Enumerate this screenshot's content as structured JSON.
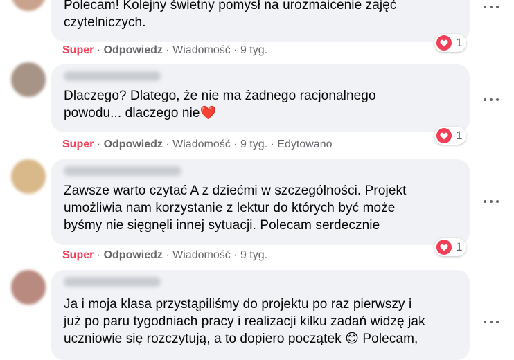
{
  "comments": [
    {
      "text": "Polecam! Kolejny świetny pomysł na urozmaicenie zajęć\nczytelniczych.",
      "reaction": "Super",
      "reply": "Odpowiedz",
      "message": "Wiadomość",
      "time": "9 tyg.",
      "edited": "",
      "reaction_count": "1"
    },
    {
      "text": "Dlaczego? Dlatego, że nie ma żadnego racjonalnego\npowodu... dlaczego nie",
      "emoji": "❤️",
      "reaction": "Super",
      "reply": "Odpowiedz",
      "message": "Wiadomość",
      "time": "9 tyg.",
      "edited": "Edytowano",
      "reaction_count": "1"
    },
    {
      "text": "Zawsze warto czytać A z dziećmi w szczególności. Projekt\numożliwia nam korzystanie z lektur do których być może\nbyśmy nie sięgnęli innej sytuacji. Polecam serdecznie",
      "reaction": "Super",
      "reply": "Odpowiedz",
      "message": "Wiadomość",
      "time": "9 tyg.",
      "edited": "",
      "reaction_count": "1"
    },
    {
      "text": "Ja i moja klasa przystąpiliśmy do projektu po raz pierwszy i\njuż po paru tygodniach pracy i realizacji kilku zadań widzę jak\nuczniowie się rozczytują, a to dopiero początek 😊 Polecam,"
    }
  ],
  "separator": "·",
  "colors": {
    "super": "#f33e58",
    "bubble": "#f0f2f5",
    "meta": "#65676b"
  }
}
